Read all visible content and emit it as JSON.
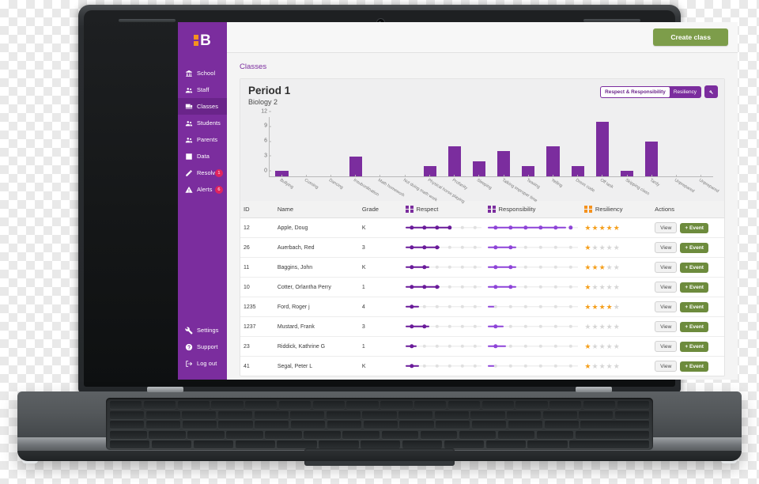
{
  "app": {
    "logo_letter": "B",
    "sidebar": {
      "items": [
        {
          "label": "School",
          "icon": "school-icon",
          "badge": null,
          "active": false
        },
        {
          "label": "Staff",
          "icon": "staff-icon",
          "badge": null,
          "active": false
        },
        {
          "label": "Classes",
          "icon": "classes-icon",
          "badge": null,
          "active": true
        },
        {
          "label": "Students",
          "icon": "students-icon",
          "badge": null,
          "active": false
        },
        {
          "label": "Parents",
          "icon": "parents-icon",
          "badge": null,
          "active": false
        },
        {
          "label": "Data",
          "icon": "data-icon",
          "badge": null,
          "active": false
        },
        {
          "label": "Resolve",
          "icon": "resolve-icon",
          "badge": "1",
          "active": false
        },
        {
          "label": "Alerts",
          "icon": "alerts-icon",
          "badge": "6",
          "active": false
        }
      ],
      "bottom_items": [
        {
          "label": "Settings",
          "icon": "wrench-icon"
        },
        {
          "label": "Support",
          "icon": "question-icon"
        },
        {
          "label": "Log out",
          "icon": "logout-icon"
        }
      ]
    },
    "topbar": {
      "create_class_label": "Create class"
    },
    "breadcrumb": "Classes",
    "card": {
      "title": "Period 1",
      "subtitle": "Biology 2",
      "toggle_options": [
        "Respect & Responsibility",
        "Resiliency"
      ],
      "toggle_selected": "Respect & Responsibility",
      "settings_icon": "wrench-icon"
    },
    "colors": {
      "brand_purple": "#7b2d9e",
      "accent_orange": "#f5921e",
      "green": "#7d9d4a",
      "badge_red": "#e0245e",
      "star_gold": "#f5a01e"
    }
  },
  "chart_data": {
    "type": "bar",
    "title": "Period 1 — Biology 2",
    "xlabel": "",
    "ylabel": "",
    "ylim": [
      0,
      12
    ],
    "yticks": [
      0,
      3,
      6,
      9,
      12
    ],
    "grid": false,
    "legend": "none",
    "bar_color": "#7b2d9e",
    "categories": [
      "Bullying",
      "Cussing",
      "Dancing",
      "Insubordination",
      "Math homework",
      "Not doing math work",
      "Physical horse playing",
      "Profanity",
      "Sleeping",
      "Talking improper time",
      "Teasing",
      "Yelling",
      "Dress code",
      "Off task",
      "Skipping class",
      "Tardy",
      "Unprepared",
      "Unprepared"
    ],
    "values": [
      1,
      0,
      0,
      4,
      0,
      0,
      2,
      6,
      3,
      5,
      2,
      6,
      2,
      11,
      1,
      7,
      0,
      0
    ]
  },
  "table": {
    "columns": [
      {
        "label": "ID",
        "icon": null
      },
      {
        "label": "Name",
        "icon": null
      },
      {
        "label": "Grade",
        "icon": null
      },
      {
        "label": "Respect",
        "icon": "quad-purple-icon"
      },
      {
        "label": "Responsibility",
        "icon": "quad-purple-icon"
      },
      {
        "label": "Resiliency",
        "icon": "quad-orange-icon"
      },
      {
        "label": "Actions",
        "icon": null
      }
    ],
    "view_label": "View",
    "event_label": "+ Event",
    "rows": [
      {
        "id": "12",
        "name": "Apple, Doug",
        "grade": "K",
        "respect": 4,
        "respect_dots": 6,
        "responsibility": 6,
        "responsibility_dots": 6,
        "resiliency": 4.5
      },
      {
        "id": "26",
        "name": "Auerbach, Red",
        "grade": "3",
        "respect": 3,
        "respect_dots": 6,
        "responsibility": 2,
        "responsibility_dots": 6,
        "resiliency": 1
      },
      {
        "id": "11",
        "name": "Baggins, John",
        "grade": "K",
        "respect": 2,
        "respect_dots": 6,
        "responsibility": 2,
        "responsibility_dots": 6,
        "resiliency": 3
      },
      {
        "id": "10",
        "name": "Cotter, Orlantha Perry",
        "grade": "1",
        "respect": 3,
        "respect_dots": 6,
        "responsibility": 2,
        "responsibility_dots": 6,
        "resiliency": 1
      },
      {
        "id": "1235",
        "name": "Ford, Roger j",
        "grade": "4",
        "respect": 1,
        "respect_dots": 6,
        "responsibility": 0.4,
        "responsibility_dots": 6,
        "resiliency": 3.5
      },
      {
        "id": "1237",
        "name": "Mustard, Frank",
        "grade": "3",
        "respect": 2,
        "respect_dots": 6,
        "responsibility": 1,
        "responsibility_dots": 6,
        "resiliency": 0
      },
      {
        "id": "23",
        "name": "Riddick, Kathrine G",
        "grade": "1",
        "respect": 0.8,
        "respect_dots": 6,
        "responsibility": 1.2,
        "responsibility_dots": 6,
        "resiliency": 0.5
      },
      {
        "id": "41",
        "name": "Segal, Peter L",
        "grade": "K",
        "respect": 1,
        "respect_dots": 6,
        "responsibility": 0.4,
        "responsibility_dots": 6,
        "resiliency": 0.5
      }
    ]
  }
}
